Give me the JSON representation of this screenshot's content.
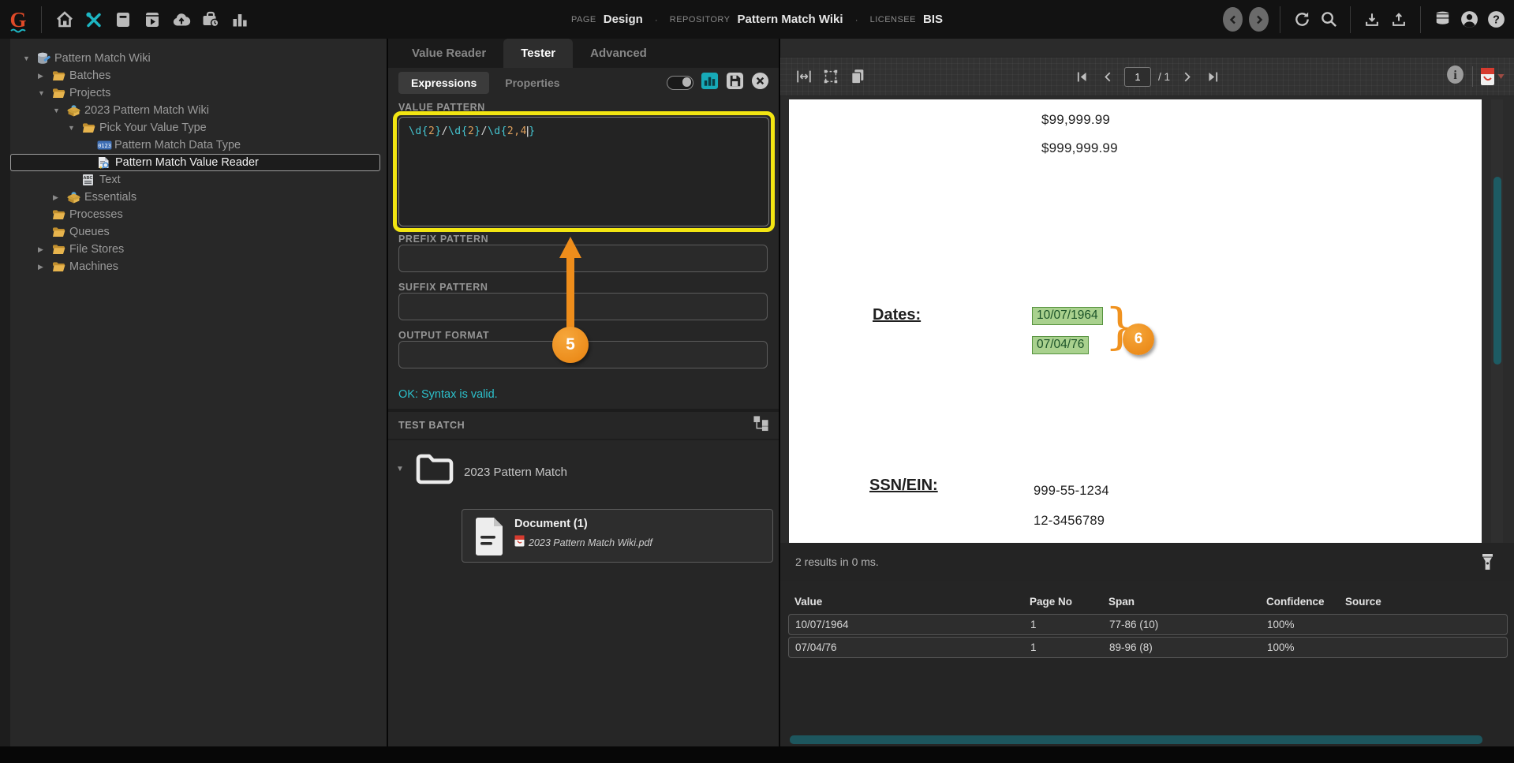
{
  "topbar": {
    "logo_letter": "G",
    "separator": "·",
    "page_label": "PAGE",
    "page_value": "Design",
    "repository_label": "REPOSITORY",
    "repository_value": "Pattern Match Wiki",
    "licensee_label": "LICENSEE",
    "licensee_value": "BIS"
  },
  "tree": {
    "items": [
      {
        "label": "Pattern Match Wiki",
        "level": 0,
        "arrow": "down",
        "icon": "database"
      },
      {
        "label": "Batches",
        "level": 1,
        "arrow": "right",
        "icon": "folder"
      },
      {
        "label": "Projects",
        "level": 1,
        "arrow": "down",
        "icon": "folder"
      },
      {
        "label": "2023 Pattern Match Wiki",
        "level": 2,
        "arrow": "down",
        "icon": "project"
      },
      {
        "label": "Pick Your Value Type",
        "level": 3,
        "arrow": "down",
        "icon": "folder"
      },
      {
        "label": "Pattern Match Data Type",
        "level": 4,
        "arrow": "none",
        "icon": "datatype"
      },
      {
        "label": "Pattern Match Value Reader",
        "level": 4,
        "arrow": "none",
        "icon": "valuereader",
        "selected": true
      },
      {
        "label": "Text",
        "level": 3,
        "arrow": "none",
        "icon": "text"
      },
      {
        "label": "Essentials",
        "level": 2,
        "arrow": "right",
        "icon": "project"
      },
      {
        "label": "Processes",
        "level": 1,
        "arrow": "none",
        "icon": "folder"
      },
      {
        "label": "Queues",
        "level": 1,
        "arrow": "none",
        "icon": "folder"
      },
      {
        "label": "File Stores",
        "level": 1,
        "arrow": "right",
        "icon": "folder"
      },
      {
        "label": "Machines",
        "level": 1,
        "arrow": "right",
        "icon": "folder"
      }
    ]
  },
  "tabs": {
    "main": [
      {
        "label": "Value Reader",
        "active": false
      },
      {
        "label": "Tester",
        "active": true
      },
      {
        "label": "Advanced",
        "active": false
      }
    ],
    "sub": [
      {
        "label": "Expressions",
        "active": true
      },
      {
        "label": "Properties",
        "active": false
      }
    ]
  },
  "editor": {
    "value_pattern_label": "VALUE PATTERN",
    "pattern_text": "\\d{2}/\\d{2}/\\d{2,4}",
    "pattern_tokens": [
      {
        "t": "\\d",
        "c": "re"
      },
      {
        "t": "{",
        "c": "re"
      },
      {
        "t": "2",
        "c": "num"
      },
      {
        "t": "}",
        "c": "re"
      },
      {
        "t": "/",
        "c": "pl"
      },
      {
        "t": "\\d",
        "c": "re"
      },
      {
        "t": "{",
        "c": "re"
      },
      {
        "t": "2",
        "c": "num"
      },
      {
        "t": "}",
        "c": "re"
      },
      {
        "t": "/",
        "c": "pl"
      },
      {
        "t": "\\d",
        "c": "re"
      },
      {
        "t": "{",
        "c": "re"
      },
      {
        "t": "2",
        "c": "num"
      },
      {
        "t": ",",
        "c": "num"
      },
      {
        "t": "4",
        "c": "num"
      },
      {
        "t": "|",
        "c": "caret"
      },
      {
        "t": "}",
        "c": "re"
      }
    ],
    "prefix_label": "PREFIX PATTERN",
    "suffix_label": "SUFFIX PATTERN",
    "output_label": "OUTPUT FORMAT",
    "status_message": "OK: Syntax is valid."
  },
  "annotations": {
    "step5": "5",
    "step6": "6"
  },
  "test_batch": {
    "title": "TEST BATCH",
    "folder_label": "2023 Pattern Match",
    "doc_title": "Document (1)",
    "doc_filename": "2023 Pattern Match Wiki.pdf"
  },
  "viewer": {
    "page_current": "1",
    "page_total": "/ 1"
  },
  "document": {
    "amounts": [
      "$99,999.99",
      "$999,999.99"
    ],
    "dates_label": "Dates:",
    "dates": [
      "10/07/1964",
      "07/04/76"
    ],
    "brace": "}",
    "ssn_label": "SSN/EIN:",
    "ssn_values": [
      "999-55-1234",
      "12-3456789"
    ]
  },
  "results": {
    "summary": "2 results in 0 ms.",
    "columns": [
      "Value",
      "Page No",
      "Span",
      "Confidence",
      "Source"
    ],
    "rows": [
      [
        "10/07/1964",
        "1",
        "77-86 (10)",
        "100%",
        ""
      ],
      [
        "07/04/76",
        "1",
        "89-96 (8)",
        "100%",
        ""
      ]
    ]
  },
  "colors": {
    "accent_teal": "#2cc0cb",
    "annotation_orange": "#ee8d1b",
    "highlight_yellow": "#f2e512",
    "match_green_bg": "#a9d18e",
    "match_green_border": "#56923e",
    "scrollbar_teal": "#1d5b63"
  }
}
